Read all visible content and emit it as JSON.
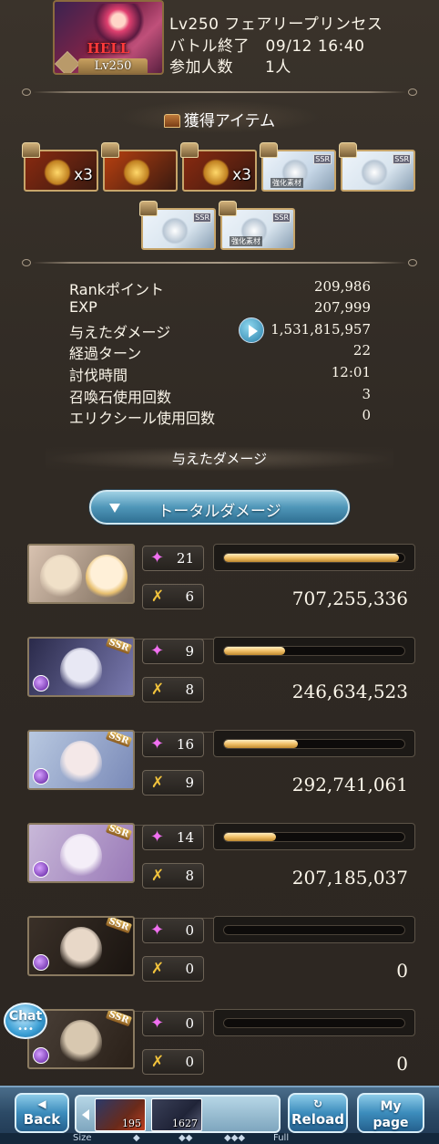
{
  "quest": {
    "thumb_difficulty": "HELL",
    "thumb_level": "Lv250",
    "title": "Lv250 フェアリープリンセス",
    "battle_end": "バトル終了　09/12 16:40",
    "participants": "参加人数　　1人"
  },
  "items_section": {
    "title": "獲得アイテム",
    "items": [
      {
        "name": "gold-medal",
        "count": "x3",
        "color": "#8a2a10"
      },
      {
        "name": "gold-book",
        "count": "",
        "color": "#b84010"
      },
      {
        "name": "crystal",
        "count": "x3",
        "color": "#8a2a10"
      },
      {
        "name": "bow-weapon",
        "count": "",
        "color": "#c8d8e8",
        "tag": "強化素材"
      },
      {
        "name": "curved-bow",
        "count": "",
        "color": "#d8e4ee"
      },
      {
        "name": "harp",
        "count": "",
        "color": "#d8e4ee"
      },
      {
        "name": "curved-blade",
        "count": "",
        "color": "#d8e4ee",
        "tag": "強化素材"
      }
    ],
    "rarity": "SSR"
  },
  "stats": [
    {
      "label": "Rankポイント",
      "value": "209,986"
    },
    {
      "label": "EXP",
      "value": "207,999"
    },
    {
      "label": "与えたダメージ",
      "value": "1,531,815,957"
    },
    {
      "label": "経過ターン",
      "value": "22"
    },
    {
      "label": "討伐時間",
      "value": "12:01"
    },
    {
      "label": "召喚石使用回数",
      "value": "3"
    },
    {
      "label": "エリクシール使用回数",
      "value": "0"
    }
  ],
  "damage_section": {
    "title": "与えたダメージ",
    "total_button": "トータルダメージ"
  },
  "characters": [
    {
      "hits": "21",
      "specials": "6",
      "damage": "707,255,336",
      "share": 0.97
    },
    {
      "hits": "9",
      "specials": "8",
      "damage": "246,634,523",
      "share": 0.34
    },
    {
      "hits": "16",
      "specials": "9",
      "damage": "292,741,061",
      "share": 0.41
    },
    {
      "hits": "14",
      "specials": "8",
      "damage": "207,185,037",
      "share": 0.29
    },
    {
      "hits": "0",
      "specials": "0",
      "damage": "0",
      "share": 0
    },
    {
      "hits": "0",
      "specials": "0",
      "damage": "0",
      "share": 0
    }
  ],
  "chat": {
    "label": "Chat",
    "dots": "•••"
  },
  "footer": {
    "back": "Back",
    "reload": "Reload",
    "mypage": "My page",
    "tray": [
      {
        "count": "195"
      },
      {
        "count": "1627"
      }
    ],
    "size_label": "Size",
    "full_label": "Full"
  }
}
